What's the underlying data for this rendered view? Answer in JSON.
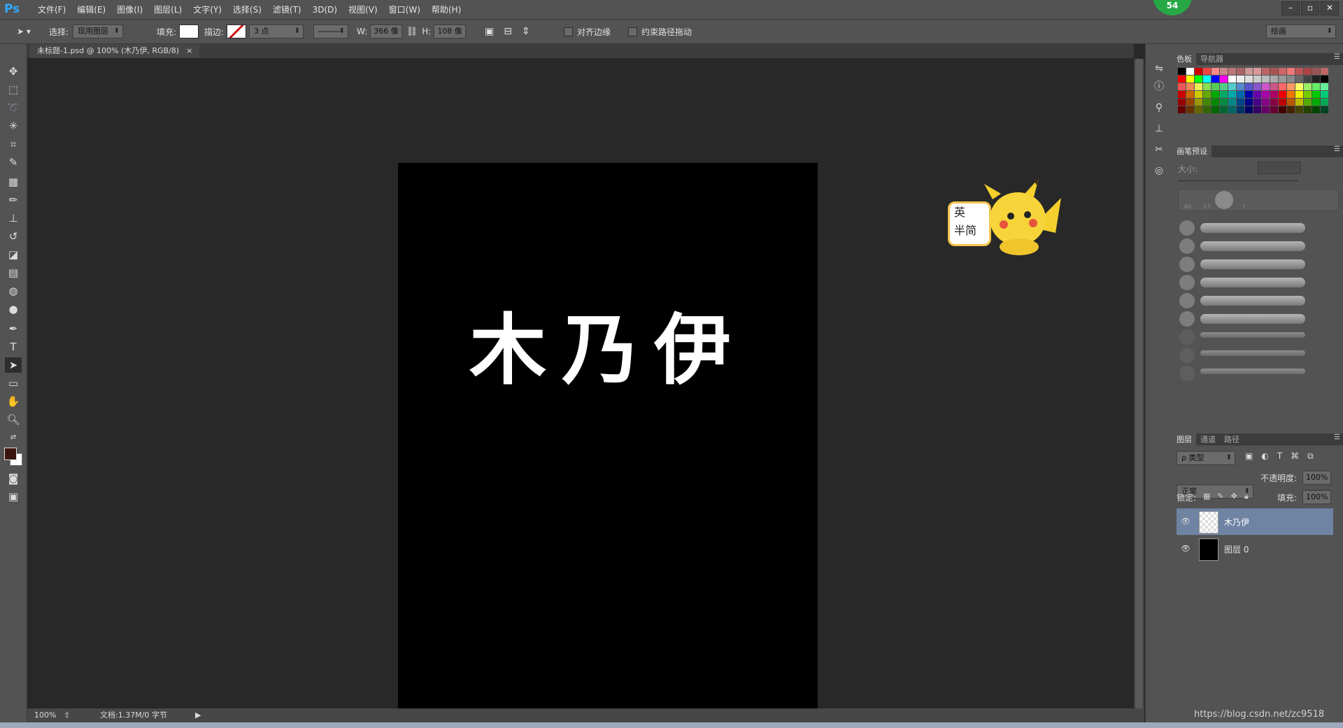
{
  "app": {
    "logo": "Ps",
    "badge": "54",
    "menu": [
      "文件(F)",
      "编辑(E)",
      "图像(I)",
      "图层(L)",
      "文字(Y)",
      "选择(S)",
      "滤镜(T)",
      "3D(D)",
      "视图(V)",
      "窗口(W)",
      "帮助(H)"
    ],
    "window_buttons": [
      "–",
      "▫",
      "✕"
    ]
  },
  "options": {
    "select_label": "选择:",
    "select_value": "现用图层",
    "fill_label": "填充:",
    "stroke_label": "描边:",
    "stroke_size": "3 点",
    "w_label": "W:",
    "w_value": "366 像",
    "h_label": "H:",
    "h_value": "108 像",
    "align_edges": "对齐边缘",
    "constrain_path": "约束路径拖动",
    "workspace": "绘画"
  },
  "document": {
    "tab_title": "未标题-1.psd @ 100% (木乃伊, RGB/8)",
    "tab_close": "×",
    "canvas_text": "木乃伊",
    "zoom": "100%",
    "doc_info": "文档:1.37M/0 字节"
  },
  "ime": {
    "line1": "英",
    "line2": "半简"
  },
  "panels": {
    "swatches_tabs": [
      "色板",
      "导航器"
    ],
    "brush_presets_title": "画笔预设",
    "brush_size_label": "大小:",
    "brush_sizes": [
      "60",
      "13",
      "7"
    ],
    "layers_tabs": [
      "图层",
      "通道",
      "路径"
    ],
    "filter_kind": "ρ 类型",
    "blend_mode": "正常",
    "opacity_label": "不透明度:",
    "opacity_value": "100%",
    "lock_label": "锁定:",
    "fill_label": "填充:",
    "fill_value": "100%",
    "layers": [
      {
        "name": "木乃伊",
        "selected": true
      },
      {
        "name": "图层 0",
        "selected": false
      }
    ]
  },
  "watermark": "https://blog.csdn.net/zc9518",
  "colors": {
    "foreground": "#3a1510",
    "background": "#ffffff",
    "selected_layer": "#6f83a3"
  }
}
